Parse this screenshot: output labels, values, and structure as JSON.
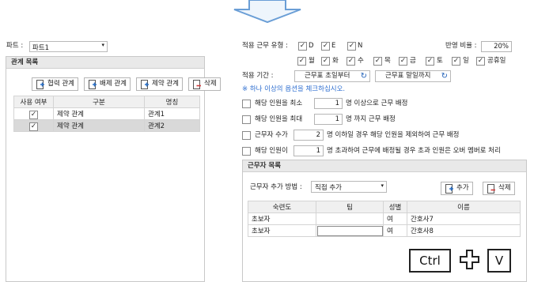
{
  "part": {
    "label": "파트 :",
    "value": "파트1"
  },
  "relations": {
    "title": "관계 목록",
    "buttons": {
      "cooperate": "협력 관계",
      "exclude": "배제 관계",
      "constraint": "제약 관계",
      "delete": "삭제"
    },
    "columns": [
      "사용 여부",
      "구분",
      "명칭"
    ],
    "rows": [
      {
        "checked": "✓",
        "type": "제약 관계",
        "name": "관계1"
      },
      {
        "checked": "✓",
        "type": "제약 관계",
        "name": "관계2"
      }
    ]
  },
  "shift": {
    "label": "적용 근무 유형 :",
    "types": [
      {
        "checked": "✓",
        "label": "D"
      },
      {
        "checked": "✓",
        "label": "E"
      },
      {
        "checked": "✓",
        "label": "N"
      }
    ]
  },
  "ratio": {
    "label": "반영 비율 :",
    "value": "20%"
  },
  "days": [
    {
      "checked": "✓",
      "label": "월"
    },
    {
      "checked": "✓",
      "label": "화"
    },
    {
      "checked": "✓",
      "label": "수"
    },
    {
      "checked": "✓",
      "label": "목"
    },
    {
      "checked": "✓",
      "label": "금"
    },
    {
      "checked": "✓",
      "label": "토"
    },
    {
      "checked": "✓",
      "label": "일"
    },
    {
      "checked": "✓",
      "label": "공휴일"
    }
  ],
  "period": {
    "label": "적용 기간 :",
    "from": "근무표 초일부터",
    "to": "근무표 말일까지"
  },
  "notice": "※ 하나 이상의 옵션을 체크하십시오.",
  "options": [
    {
      "pre": "해당 인원을 최소",
      "value": "1",
      "post": "명 이상으로 근무 배정"
    },
    {
      "pre": "해당 인원을 최대",
      "value": "1",
      "post": "명 까지 근무 배정"
    },
    {
      "pre": "근무자 수가",
      "value": "2",
      "post": "명 이하일 경우 해당 인원을 제외하여 근무 배정"
    },
    {
      "pre": "해당 인원이",
      "value": "1",
      "post": "명 초과하여 근무에 배정될 경우 초과 인원은 오버 멤버로 처리"
    }
  ],
  "workers": {
    "title": "근무자 목록",
    "method_label": "근무자 추가 방법 :",
    "method_value": "직접 추가",
    "add": "추가",
    "delete": "삭제",
    "columns": [
      "숙련도",
      "팀",
      "성별",
      "이름"
    ],
    "rows": [
      {
        "skill": "초보자",
        "team": "",
        "gender": "여",
        "name": "간호사7"
      },
      {
        "skill": "초보자",
        "team": "",
        "gender": "여",
        "name": "간호사8"
      }
    ]
  },
  "keys": {
    "ctrl": "Ctrl",
    "plus": "+",
    "v": "V"
  },
  "colors": {
    "arrow": "#6a9ed6",
    "notice": "#2f6fd0",
    "panel_header": "#e9e9e9",
    "selected_row": "#d9d9d9"
  }
}
